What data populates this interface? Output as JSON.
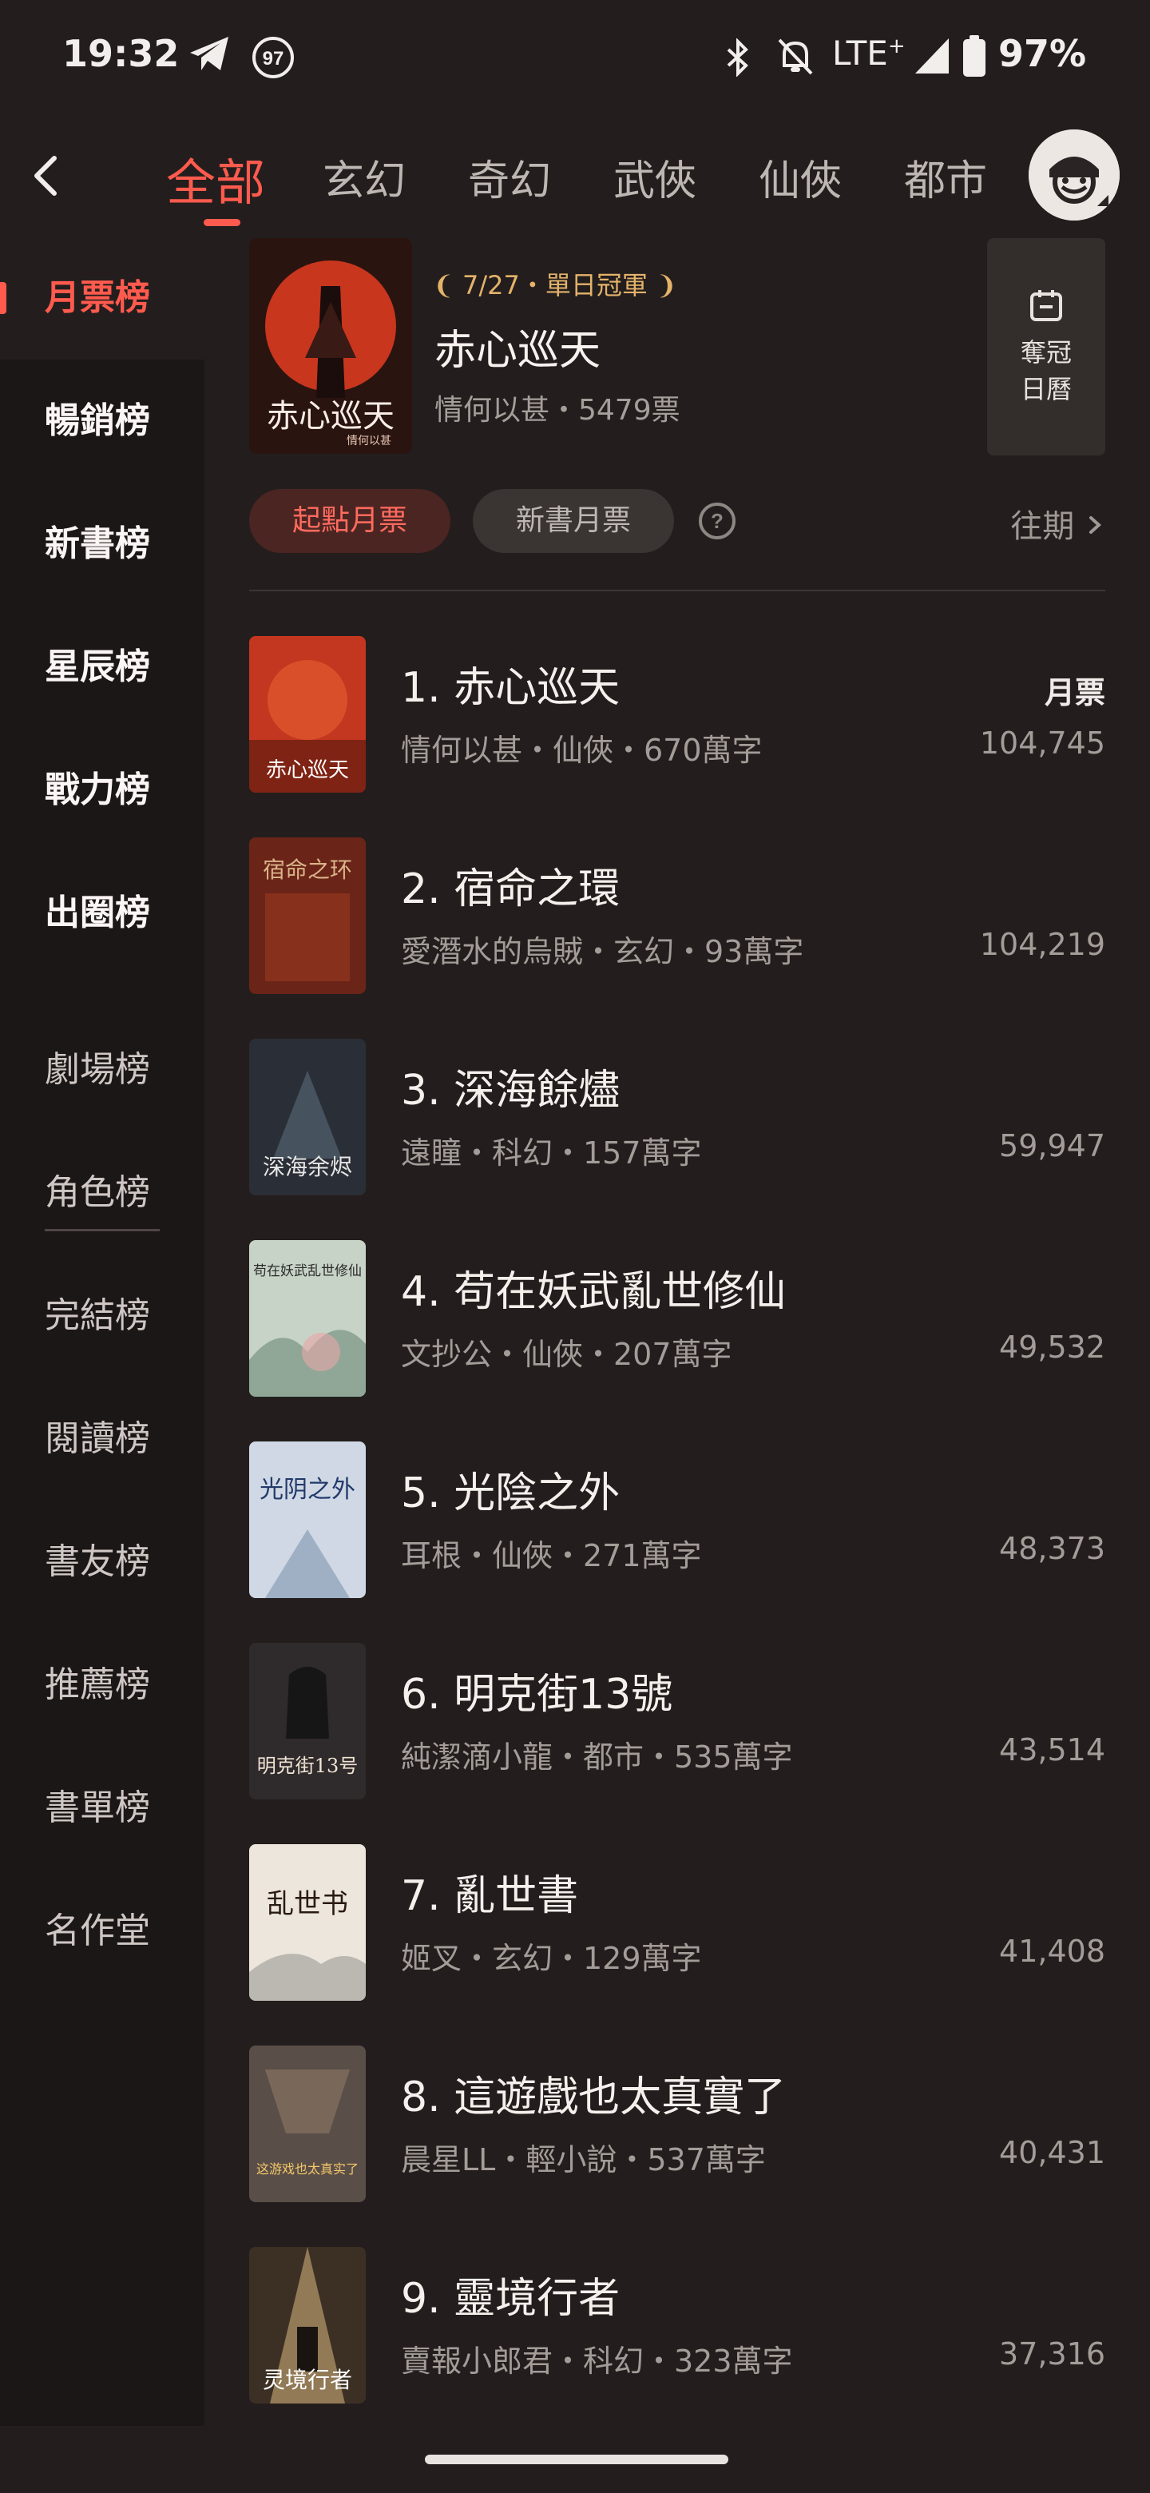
{
  "status": {
    "time": "19:32",
    "notif_count": "97",
    "network": "LTE",
    "network_sup": "+",
    "battery": "97%"
  },
  "top_tabs": [
    "全部",
    "玄幻",
    "奇幻",
    "武俠",
    "仙俠",
    "都市"
  ],
  "active_tab": "全部",
  "sidebar": {
    "selected": "月票榜",
    "items": [
      "月票榜",
      "暢銷榜",
      "新書榜",
      "星辰榜",
      "戰力榜",
      "出圈榜",
      "劇場榜",
      "角色榜",
      "完結榜",
      "閱讀榜",
      "書友榜",
      "推薦榜",
      "書單榜",
      "名作堂"
    ]
  },
  "hero": {
    "badge": "7/27・單日冠軍",
    "title": "赤心巡天",
    "subtitle": "情何以甚・5479票",
    "cover_text": "赤心巡天",
    "cover_author": "情何以甚",
    "calendar_line1": "奪冠",
    "calendar_line2": "日曆"
  },
  "filters": {
    "active": "起點月票",
    "inactive": "新書月票",
    "past": "往期"
  },
  "ranking": {
    "column_label": "月票",
    "items": [
      {
        "title": "1. 赤心巡天",
        "meta": "情何以甚・仙俠・670萬字",
        "count": "104,745",
        "cover_text": "赤心巡天",
        "color": "#c3361f"
      },
      {
        "title": "2. 宿命之環",
        "meta": "愛潛水的烏賊・玄幻・93萬字",
        "count": "104,219",
        "cover_text": "宿命之环",
        "color": "#6b2418"
      },
      {
        "title": "3. 深海餘燼",
        "meta": "遠瞳・科幻・157萬字",
        "count": "59,947",
        "cover_text": "深海余烬",
        "color": "#2a2e36"
      },
      {
        "title": "4. 苟在妖武亂世修仙",
        "meta": "文抄公・仙俠・207萬字",
        "count": "49,532",
        "cover_text": "苟在妖武乱世修仙",
        "color": "#c7d3c6"
      },
      {
        "title": "5. 光陰之外",
        "meta": "耳根・仙俠・271萬字",
        "count": "48,373",
        "cover_text": "光阴之外",
        "color": "#cfd8e4"
      },
      {
        "title": "6. 明克街13號",
        "meta": "純潔滴小龍・都市・535萬字",
        "count": "43,514",
        "cover_text": "明克街13号",
        "color": "#2f2a2b"
      },
      {
        "title": "7. 亂世書",
        "meta": "姬叉・玄幻・129萬字",
        "count": "41,408",
        "cover_text": "乱世书",
        "color": "#ece6dc"
      },
      {
        "title": "8. 這遊戲也太真實了",
        "meta": "晨星LL・輕小說・537萬字",
        "count": "40,431",
        "cover_text": "这游戏也太真实了",
        "color": "#5a4e48"
      },
      {
        "title": "9. 靈境行者",
        "meta": "賣報小郎君・科幻・323萬字",
        "count": "37,316",
        "cover_text": "灵境行者",
        "color": "#3c3024"
      }
    ]
  },
  "colors": {
    "accent": "#ff5a4e",
    "background": "#231e1d",
    "sidebar": "#1b1716",
    "badge_gold": "#e4b26a"
  }
}
